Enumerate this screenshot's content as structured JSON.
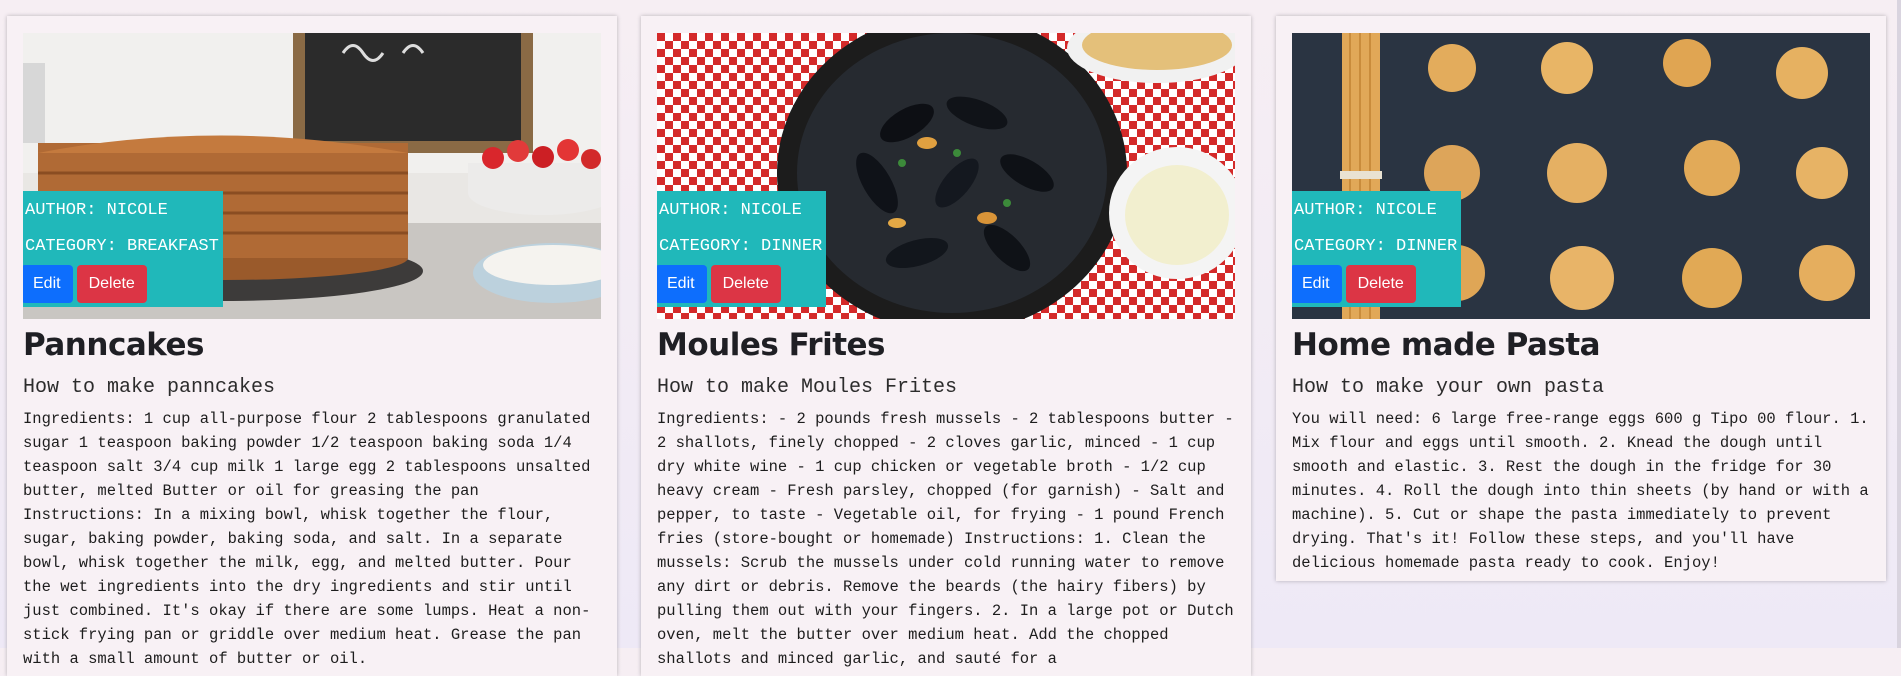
{
  "buttons": {
    "edit_label": "Edit",
    "delete_label": "Delete"
  },
  "colors": {
    "meta_box": "#20b8ba",
    "edit_button": "#0d6efd",
    "delete_button": "#dc3545",
    "card_background": "#f8f1f5"
  },
  "recipes": [
    {
      "author_label": "AUTHOR: NICOLE",
      "category_label": "CATEGORY: BREAKFAST",
      "title": "Panncakes",
      "subtitle": "How to make panncakes",
      "body": "Ingredients: 1 cup all-purpose flour 2 tablespoons granulated sugar 1 teaspoon baking powder 1/2 teaspoon baking soda 1/4 teaspoon salt 3/4 cup milk 1 large egg 2 tablespoons unsalted butter, melted Butter or oil for greasing the pan Instructions: In a mixing bowl, whisk together the flour, sugar, baking powder, baking soda, and salt. In a separate bowl, whisk together the milk, egg, and melted butter. Pour the wet ingredients into the dry ingredients and stir until just combined. It's okay if there are some lumps. Heat a non-stick frying pan or griddle over medium heat. Grease the pan with a small amount of butter or oil."
    },
    {
      "author_label": "AUTHOR: NICOLE",
      "category_label": "CATEGORY: DINNER",
      "title": "Moules Frites",
      "subtitle": "How to make Moules Frites",
      "body": "Ingredients: - 2 pounds fresh mussels - 2 tablespoons butter - 2 shallots, finely chopped - 2 cloves garlic, minced - 1 cup dry white wine - 1 cup chicken or vegetable broth - 1/2 cup heavy cream - Fresh parsley, chopped (for garnish) - Salt and pepper, to taste - Vegetable oil, for frying - 1 pound French fries (store-bought or homemade) Instructions: 1. Clean the mussels: Scrub the mussels under cold running water to remove any dirt or debris. Remove the beards (the hairy fibers) by pulling them out with your fingers. 2. In a large pot or Dutch oven, melt the butter over medium heat. Add the chopped shallots and minced garlic, and sauté for a"
    },
    {
      "author_label": "AUTHOR: NICOLE",
      "category_label": "CATEGORY: DINNER",
      "title": "Home made Pasta",
      "subtitle": "How to make your own pasta",
      "body": "You will need: 6 large free-range eggs 600 g Tipo 00 flour. 1. Mix flour and eggs until smooth. 2. Knead the dough until smooth and elastic. 3. Rest the dough in the fridge for 30 minutes. 4. Roll the dough into thin sheets (by hand or with a machine). 5. Cut or shape the pasta immediately to prevent drying. That's it! Follow these steps, and you'll have delicious homemade pasta ready to cook. Enjoy!"
    }
  ]
}
